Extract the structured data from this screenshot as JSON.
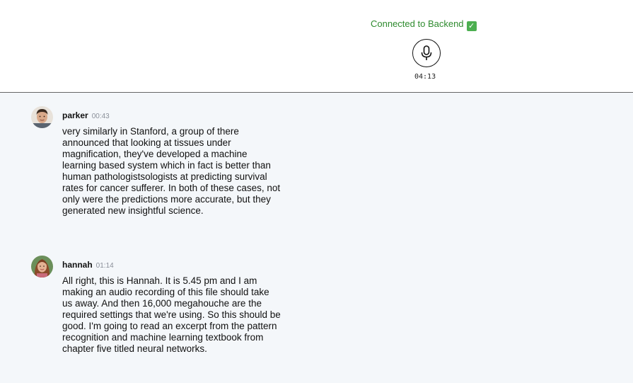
{
  "header": {
    "status_text": "Connected to Backend",
    "status_icon": "check-mark-icon",
    "mic_icon": "microphone-icon",
    "timer": "04:13"
  },
  "colors": {
    "status_green": "#2e8b2e",
    "feed_background": "#f4f7fa",
    "timestamp_gray": "#8a8f99"
  },
  "messages": [
    {
      "speaker": "parker",
      "time": "00:43",
      "text": "very similarly in Stanford, a group of there announced that looking at tissues under magnification, they've developed a machine learning based system which in fact is better than human pathologistsologists at predicting survival rates for cancer sufferer. In both of these cases, not only were the predictions more accurate, but they generated new insightful science."
    },
    {
      "speaker": "hannah",
      "time": "01:14",
      "text": "All right, this is Hannah. It is 5.45 pm and I am making an audio recording of this file should take us away. And then 16,000 megahouche are the required settings that we're using. So this should be good. I'm going to read an excerpt from the pattern recognition and machine learning textbook from chapter five titled neural networks."
    }
  ]
}
